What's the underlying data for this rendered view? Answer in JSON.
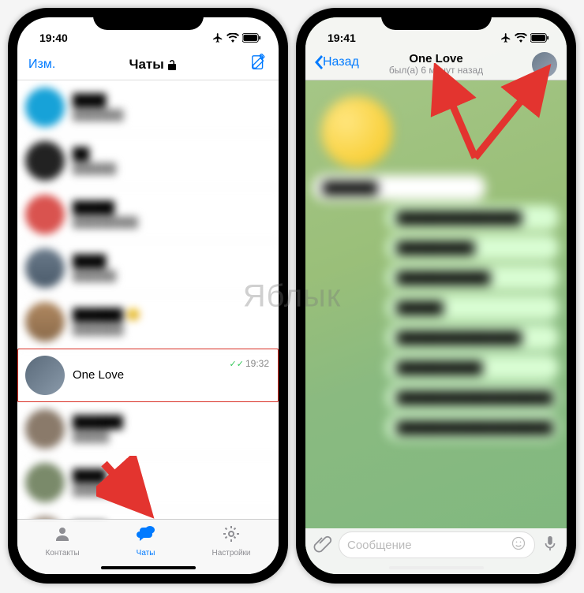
{
  "watermark": "Яблык",
  "left": {
    "status": {
      "time": "19:40"
    },
    "nav": {
      "edit": "Изм.",
      "title": "Чаты"
    },
    "highlighted_chat": {
      "name": "One Love",
      "time": "19:32"
    },
    "tabs": {
      "contacts": "Контакты",
      "chats": "Чаты",
      "settings": "Настройки"
    },
    "blur_rows": [
      {
        "color": "#17a2d8"
      },
      {
        "color": "#222"
      },
      {
        "color": "#d9534f"
      },
      {
        "color": "#6a7a8a"
      },
      {
        "color": "#b08860"
      },
      {
        "color": "#8a7a6a"
      },
      {
        "color": "#7a8a6a"
      },
      {
        "color": "#9a8a7a"
      }
    ]
  },
  "right": {
    "status": {
      "time": "19:41"
    },
    "header": {
      "back": "Назад",
      "title": "One Love",
      "subtitle": "был(а) 6 минут назад"
    },
    "input": {
      "placeholder": "Сообщение"
    }
  }
}
